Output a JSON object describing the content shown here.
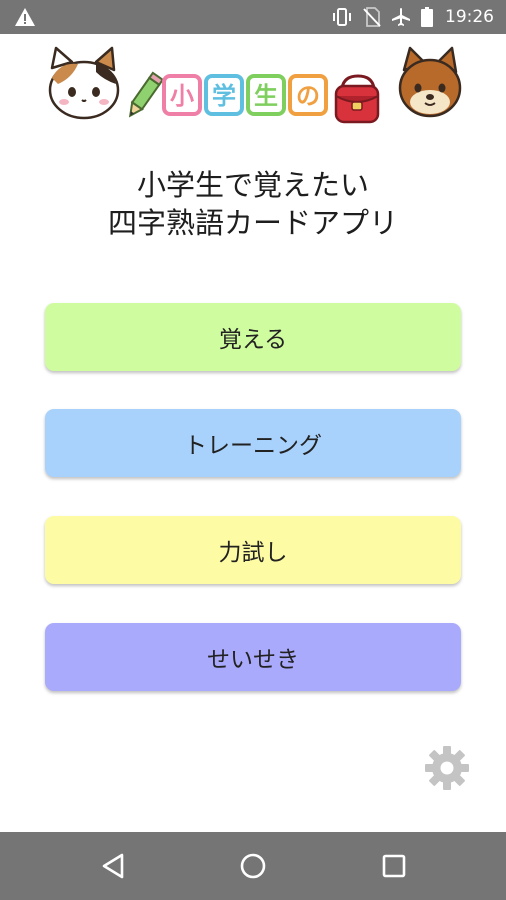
{
  "status_bar": {
    "time": "19:26",
    "icons": [
      "warning-icon",
      "vibrate-icon",
      "no-sim-icon",
      "airplane-icon",
      "battery-icon"
    ]
  },
  "header": {
    "logo_text": [
      "小",
      "学",
      "生",
      "の"
    ],
    "logo_colors": [
      "#ef7fa6",
      "#5fbfe0",
      "#7fcf5f",
      "#f0a040"
    ]
  },
  "title": {
    "line1": "小学生で覚えたい",
    "line2": "四字熟語カードアプリ"
  },
  "menu": [
    {
      "label": "覚える",
      "color": "#d0fca0"
    },
    {
      "label": "トレーニング",
      "color": "#a8d2fc"
    },
    {
      "label": "力試し",
      "color": "#fdfca4"
    },
    {
      "label": "せいせき",
      "color": "#aaaafc"
    }
  ],
  "nav": {
    "icons": [
      "back-icon",
      "home-icon",
      "recents-icon"
    ]
  }
}
